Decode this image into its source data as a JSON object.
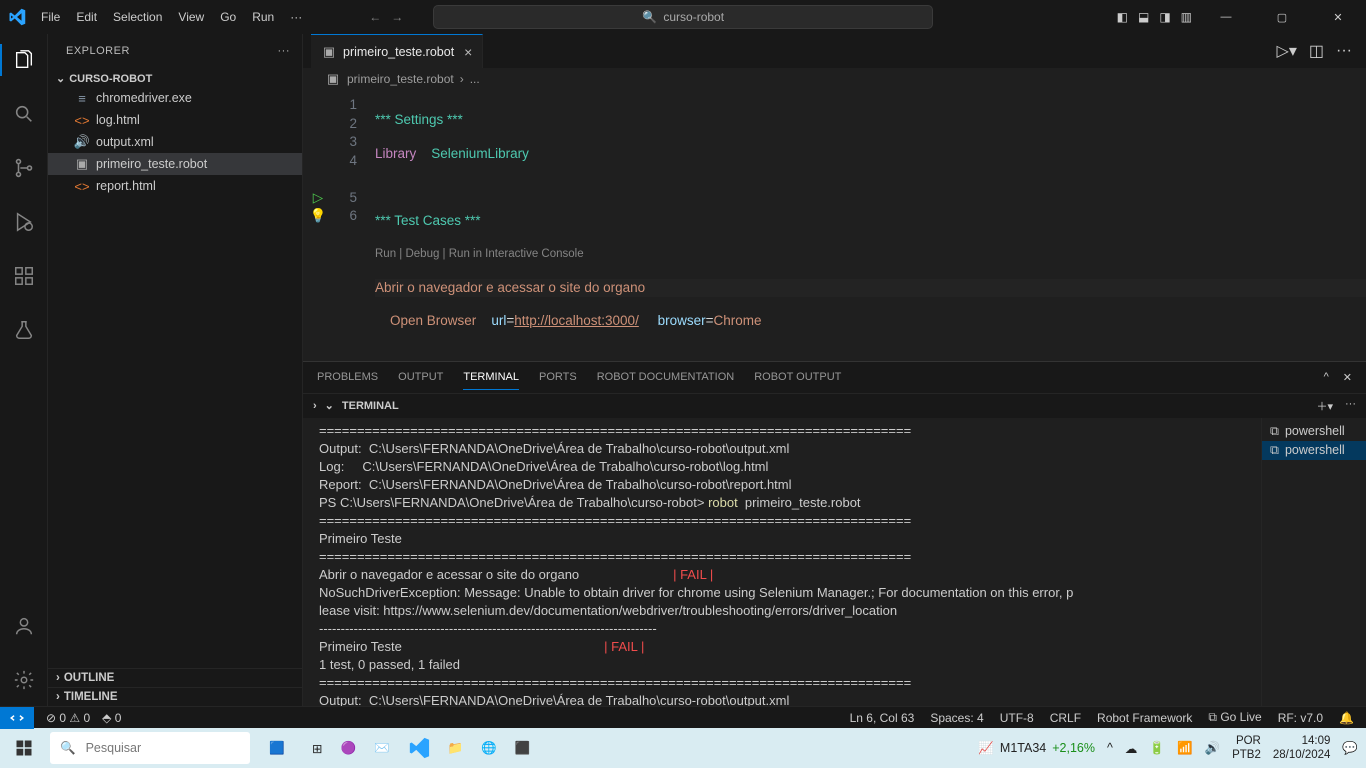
{
  "menu": {
    "file": "File",
    "edit": "Edit",
    "selection": "Selection",
    "view": "View",
    "go": "Go",
    "run": "Run"
  },
  "search_box": "curso-robot",
  "explorer": {
    "title": "EXPLORER",
    "project": "CURSO-ROBOT",
    "files": [
      "chromedriver.exe",
      "log.html",
      "output.xml",
      "primeiro_teste.robot",
      "report.html"
    ],
    "outline": "OUTLINE",
    "timeline": "TIMELINE"
  },
  "tab": {
    "name": "primeiro_teste.robot"
  },
  "breadcrumb": [
    "primeiro_teste.robot",
    "..."
  ],
  "code": {
    "l1": "*** Settings ***",
    "l2a": "Library",
    "l2b": "SeleniumLibrary",
    "l4": "*** Test Cases ***",
    "lens": "Run | Debug | Run in Interactive Console",
    "l5": "Abrir o navegador e acessar o site do organo",
    "l6_kw": "Open Browser",
    "l6_p1": "url",
    "l6_v1": "http://localhost:3000/",
    "l6_p2": "browser",
    "l6_v2": "Chrome"
  },
  "panel": {
    "tabs": [
      "PROBLEMS",
      "OUTPUT",
      "TERMINAL",
      "PORTS",
      "ROBOT DOCUMENTATION",
      "ROBOT OUTPUT"
    ],
    "head": "TERMINAL"
  },
  "terminal": {
    "sep": "==============================================================================",
    "sep2": "------------------------------------------------------------------------------",
    "out": "Output:  C:\\Users\\FERNANDA\\OneDrive\\Área de Trabalho\\curso-robot\\output.xml",
    "log": "Log:     C:\\Users\\FERNANDA\\OneDrive\\Área de Trabalho\\curso-robot\\log.html",
    "rep": "Report:  C:\\Users\\FERNANDA\\OneDrive\\Área de Trabalho\\curso-robot\\report.html",
    "ps": "PS C:\\Users\\FERNANDA\\OneDrive\\Área de Trabalho\\curso-robot> ",
    "cmd": "robot",
    "cmdarg": "  primeiro_teste.robot",
    "suite": "Primeiro Teste",
    "tc": "Abrir o navegador e acessar o site do organo                          ",
    "fail": "| FAIL |",
    "err1": "NoSuchDriverException: Message: Unable to obtain driver for chrome using Selenium Manager.; For documentation on this error, p",
    "err2": "lease visit: https://www.selenium.dev/documentation/webdriver/troubleshooting/errors/driver_location",
    "suite2": "Primeiro Teste                                                        ",
    "sum": "1 test, 0 passed, 1 failed",
    "shell": "powershell"
  },
  "status": {
    "errwarn": "⊘ 0  ⚠ 0",
    "ports": "⬘ 0",
    "lncol": "Ln 6, Col 63",
    "spaces": "Spaces: 4",
    "enc": "UTF-8",
    "eol": "CRLF",
    "lang": "Robot Framework",
    "golive": "⧉ Go Live",
    "rf": "RF: v7.0",
    "bell": "🔔"
  },
  "taskbar": {
    "search": "Pesquisar",
    "stock_name": "M1TA34",
    "stock_val": "+2,16%",
    "lang1": "POR",
    "lang2": "PTB2",
    "time": "14:09",
    "date": "28/10/2024"
  }
}
